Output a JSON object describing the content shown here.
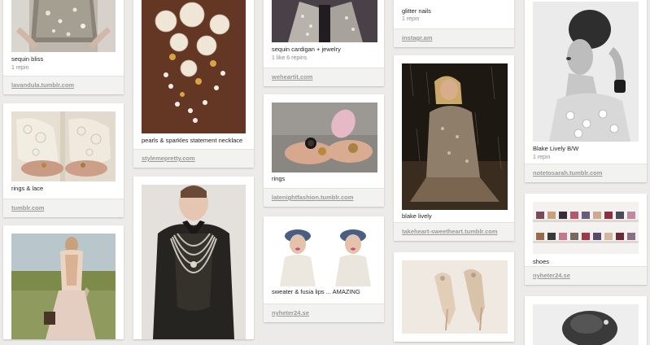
{
  "colors": {
    "page_bg": "#ecebe9",
    "card_bg": "#ffffff",
    "footer_bg": "#f2f2f0",
    "caption": "#222222",
    "muted": "#9a9a9a"
  },
  "pins": [
    {
      "id": "sequin-bliss",
      "caption": "sequin bliss",
      "stats": "1 repin",
      "source": "lavandula.tumblr.com",
      "image": "sequin-skirt-photo"
    },
    {
      "id": "rings-lace",
      "caption": "rings & lace",
      "stats": "",
      "source": "tumblr.com",
      "image": "lace-hands-rings-photo"
    },
    {
      "id": "backless-dress",
      "caption": "",
      "stats": "",
      "source": "",
      "image": "backless-dress-photo"
    },
    {
      "id": "pearls-necklace",
      "caption": "pearls & sparkles statement necklace",
      "stats": "",
      "source": "stylemepretty.com",
      "image": "pearl-necklace-photo"
    },
    {
      "id": "chanel-blouse",
      "caption": "",
      "stats": "",
      "source": "",
      "image": "chanel-chains-blouse-photo"
    },
    {
      "id": "sequin-cardigan",
      "caption": "sequin cardigan + jewelry",
      "stats": "1 like  6 repins",
      "source": "weheartit.com",
      "image": "sequin-cardigan-photo"
    },
    {
      "id": "rings",
      "caption": "rings",
      "stats": "",
      "source": "latenightfashion.tumblr.com",
      "image": "cocktail-rings-photo"
    },
    {
      "id": "sweater-lips",
      "caption": "sweater & fusia lips ... AMAZING",
      "stats": "",
      "source": "nyheter24.se",
      "image": "sweater-hats-photo"
    },
    {
      "id": "glitter-nails",
      "caption": "glitter nails",
      "stats": "1 repin",
      "source": "instagr.am",
      "image": "glitter-nails-photo"
    },
    {
      "id": "blake-lively",
      "caption": "blake lively",
      "stats": "",
      "source": "takeheart-sweetheart.tumblr.com",
      "image": "blake-lively-rain-photo"
    },
    {
      "id": "heels",
      "caption": "",
      "stats": "",
      "source": "",
      "image": "heels-photo"
    },
    {
      "id": "blake-bw",
      "caption": "Blake Lively B/W",
      "stats": "1 repin",
      "source": "notetosarah.tumblr.com",
      "image": "blake-lively-bw-photo"
    },
    {
      "id": "shoes",
      "caption": "shoes",
      "stats": "",
      "source": "nyheter24.se",
      "image": "shoe-shelves-photo"
    },
    {
      "id": "updo",
      "caption": "",
      "stats": "",
      "source": "",
      "image": "updo-hair-photo"
    }
  ]
}
